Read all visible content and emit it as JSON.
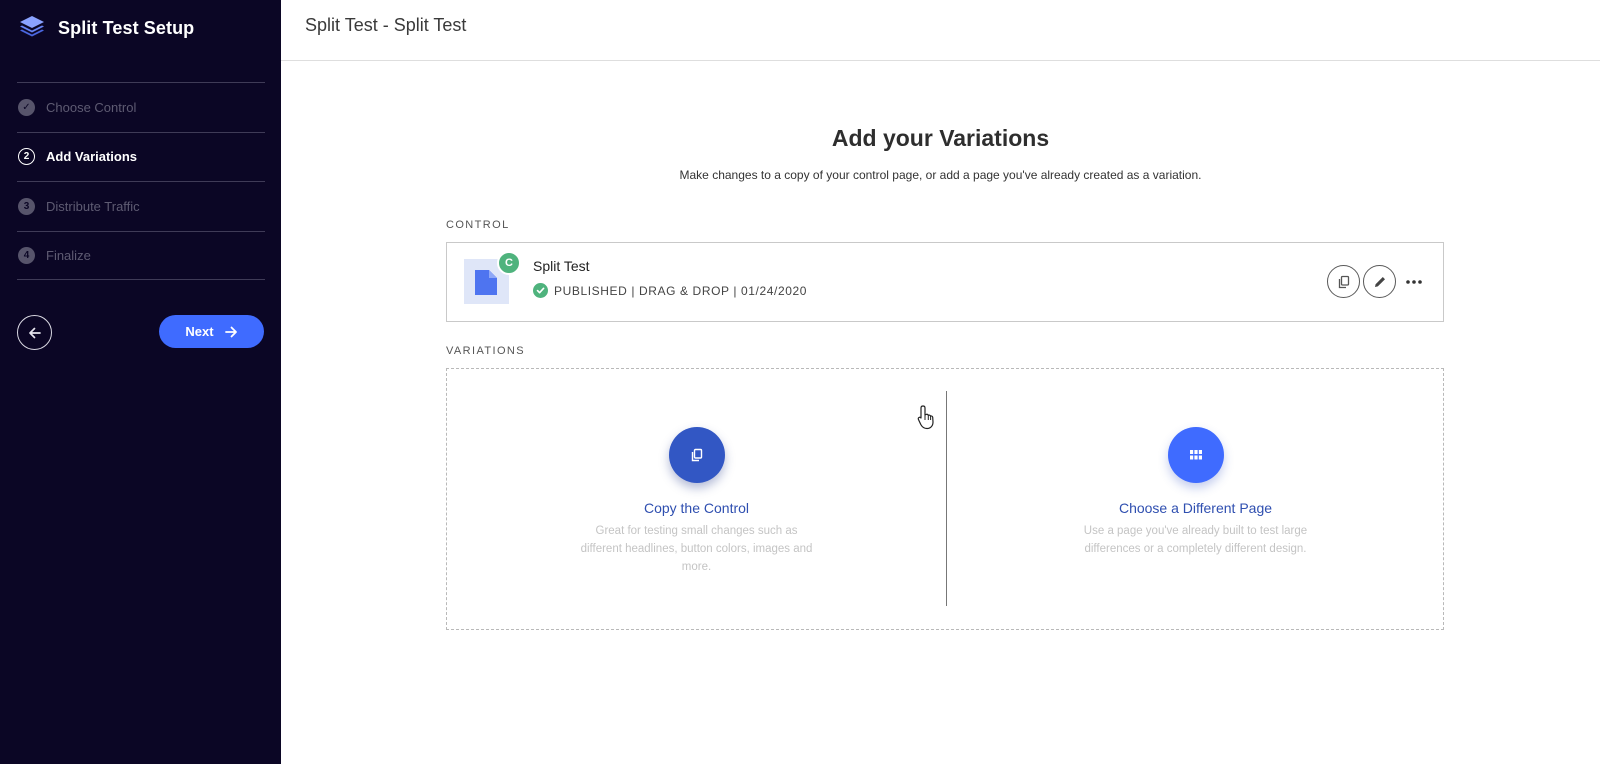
{
  "sidebar": {
    "title": "Split Test Setup",
    "steps": [
      {
        "marker": "✓",
        "label": "Choose Control",
        "state": "done"
      },
      {
        "marker": "2",
        "label": "Add Variations",
        "state": "active"
      },
      {
        "marker": "3",
        "label": "Distribute Traffic",
        "state": "todo"
      },
      {
        "marker": "4",
        "label": "Finalize",
        "state": "todo"
      }
    ],
    "next_label": "Next"
  },
  "header": {
    "title": "Split Test - Split Test"
  },
  "main": {
    "heading": "Add your Variations",
    "subheading": "Make changes to a copy of your control page, or add a page you've already created as a variation.",
    "control_label": "CONTROL",
    "variations_label": "VARIATIONS",
    "control_card": {
      "badge": "C",
      "name": "Split Test",
      "status": "PUBLISHED | DRAG & DROP | 01/24/2020"
    },
    "options": [
      {
        "title": "Copy the Control",
        "description": "Great for testing small changes such as different headlines, button colors, images and more."
      },
      {
        "title": "Choose a Different Page",
        "description": "Use a page you've already built to test large differences or a completely different design."
      }
    ]
  },
  "colors": {
    "sidebar_bg": "#0b0625",
    "accent": "#3f6bff",
    "success": "#4fb37d",
    "link": "#2f4fb0"
  },
  "icons": [
    "layers-icon",
    "check-circle-icon",
    "arrow-left-icon",
    "arrow-right-icon",
    "document-icon",
    "copy-icon",
    "pencil-icon",
    "more-horizontal-icon",
    "grid-icon",
    "hand-cursor-icon"
  ]
}
